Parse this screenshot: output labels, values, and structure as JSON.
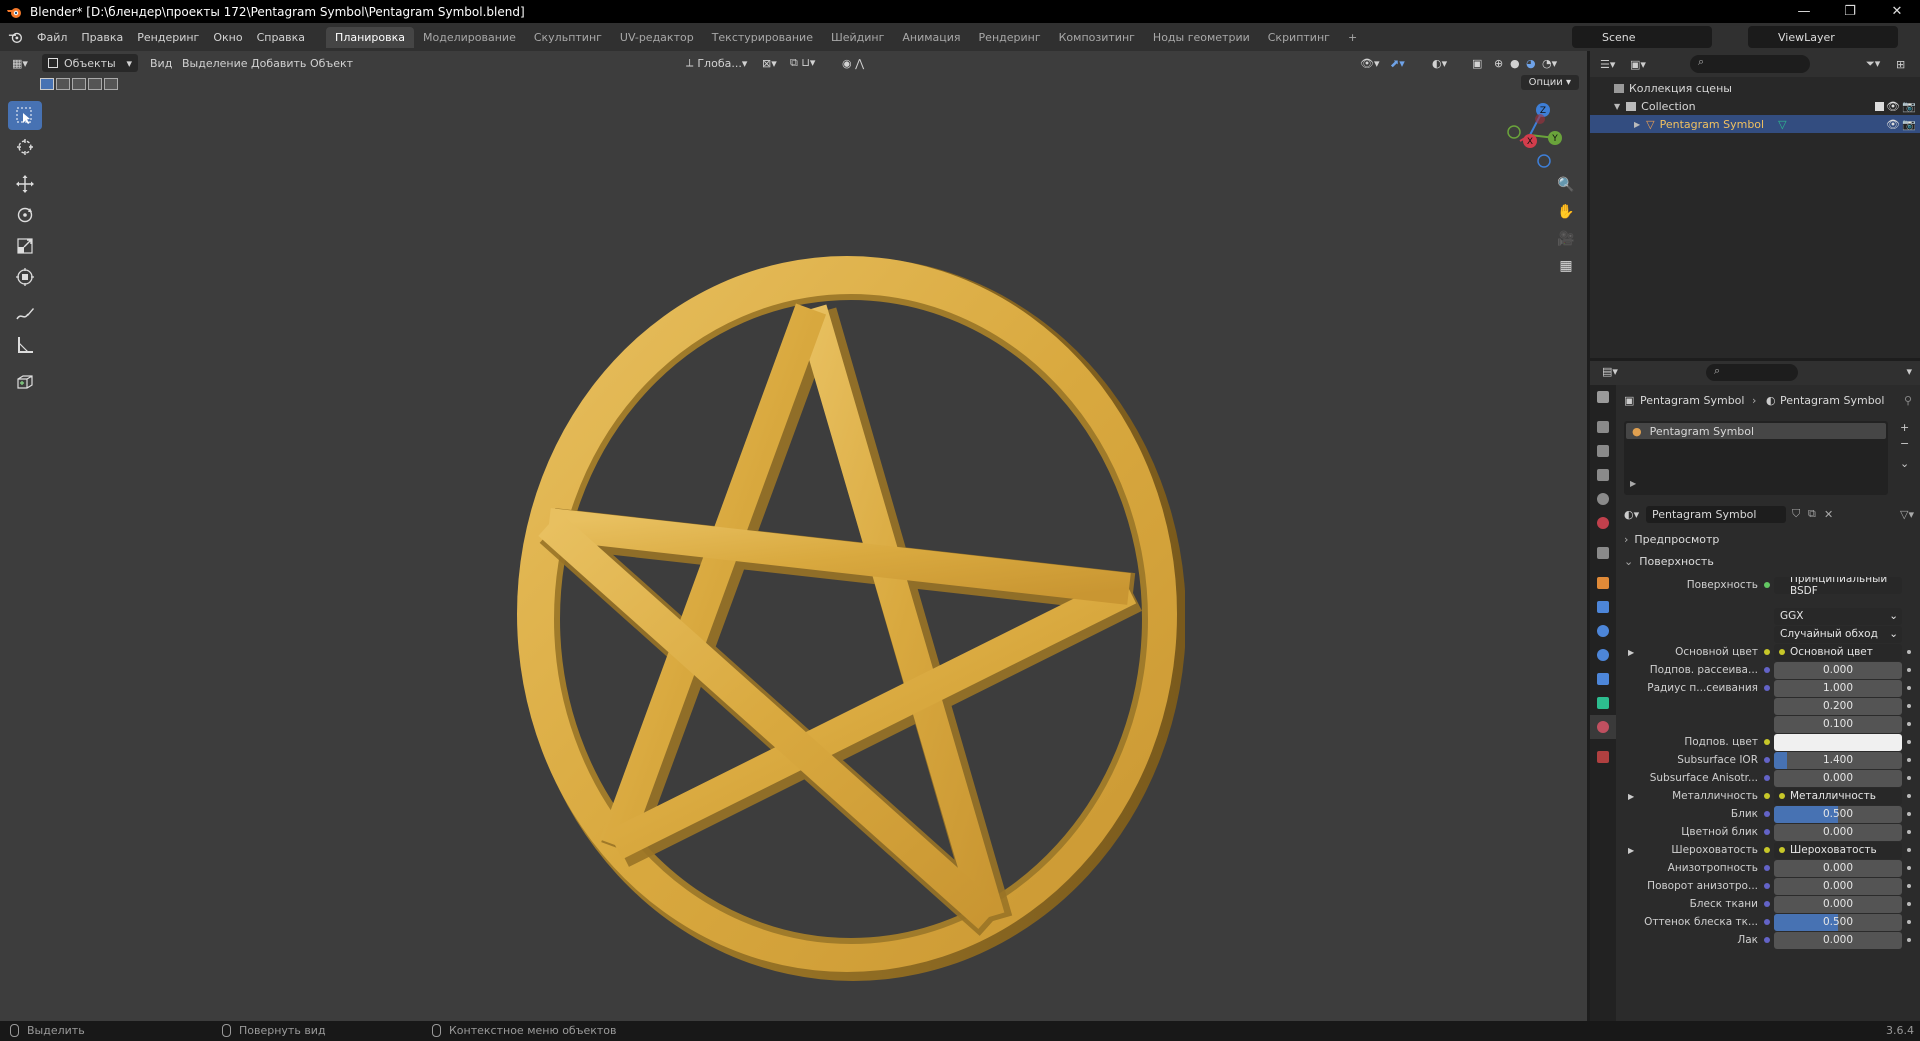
{
  "window": {
    "title": "Blender* [D:\\блендер\\проекты 172\\Pentagram Symbol\\Pentagram Symbol.blend]",
    "minimize": "—",
    "maximize": "❐",
    "close": "✕"
  },
  "menu": {
    "items": [
      "Файл",
      "Правка",
      "Рендеринг",
      "Окно",
      "Справка"
    ],
    "workspaces": [
      "Планировка",
      "Моделирование",
      "Скульптинг",
      "UV-редактор",
      "Текстурирование",
      "Шейдинг",
      "Анимация",
      "Рендеринг",
      "Композитинг",
      "Ноды геометрии",
      "Скриптинг"
    ],
    "active_workspace": "Планировка",
    "add_tab": "+",
    "scene": "Scene",
    "view_layer": "ViewLayer"
  },
  "viewport": {
    "mode": "Объекты",
    "menus": [
      "Вид",
      "Выделение",
      "Добавить",
      "Объект"
    ],
    "orientation": "Глоба...",
    "options": "Опции",
    "gizmo": {
      "x": "X",
      "y": "Y",
      "z": "Z"
    }
  },
  "outliner": {
    "scene_collection": "Коллекция сцены",
    "collection": "Collection",
    "object": "Pentagram Symbol"
  },
  "properties": {
    "breadcrumb_object": "Pentagram Symbol",
    "breadcrumb_material": "Pentagram Symbol",
    "slot": "Pentagram Symbol",
    "material_name": "Pentagram Symbol",
    "panels": {
      "preview": "Предпросмотр",
      "surface": "Поверхность"
    },
    "surface_label": "Поверхность",
    "surface_shader": "Принципиальный BSDF",
    "distribution": "GGX",
    "subsurface_method": "Случайный обход",
    "rows": [
      {
        "label": "Основной цвет",
        "value": "Основной цвет",
        "type": "link",
        "expand": true
      },
      {
        "label": "Подпов. рассеива...",
        "value": "0.000",
        "type": "num"
      },
      {
        "label": "Радиус п...сеивания",
        "value": "1.000",
        "type": "num"
      },
      {
        "label": "",
        "value": "0.200",
        "type": "num"
      },
      {
        "label": "",
        "value": "0.100",
        "type": "num"
      },
      {
        "label": "Подпов. цвет",
        "value": "",
        "type": "color"
      },
      {
        "label": "Subsurface IOR",
        "value": "1.400",
        "type": "slider",
        "fill": 0.1
      },
      {
        "label": "Subsurface Anisotr...",
        "value": "0.000",
        "type": "num"
      },
      {
        "label": "Металличность",
        "value": "Металличность",
        "type": "link",
        "expand": true
      },
      {
        "label": "Блик",
        "value": "0.500",
        "type": "slider",
        "fill": 0.5
      },
      {
        "label": "Цветной блик",
        "value": "0.000",
        "type": "num"
      },
      {
        "label": "Шероховатость",
        "value": "Шероховатость",
        "type": "link",
        "expand": true
      },
      {
        "label": "Анизотропность",
        "value": "0.000",
        "type": "num"
      },
      {
        "label": "Поворот анизотро...",
        "value": "0.000",
        "type": "num"
      },
      {
        "label": "Блеск ткани",
        "value": "0.000",
        "type": "num"
      },
      {
        "label": "Оттенок блеска тк...",
        "value": "0.500",
        "type": "slider",
        "fill": 0.5
      },
      {
        "label": "Лак",
        "value": "0.000",
        "type": "num"
      }
    ]
  },
  "status": {
    "select": "Выделить",
    "rotate": "Повернуть вид",
    "context": "Контекстное меню объектов",
    "version": "3.6.4"
  },
  "colors": {
    "accent": "#4772b3",
    "gold": "#d4a843",
    "viewport_bg": "#3d3d3d"
  }
}
